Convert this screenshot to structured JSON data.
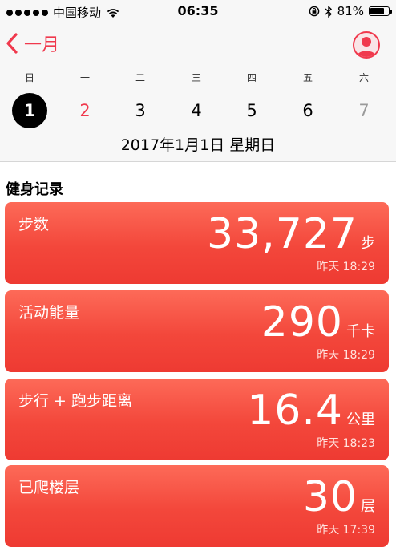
{
  "status_bar": {
    "carrier": "中国移动",
    "time": "06:35",
    "battery": "81%",
    "battery_level": 0.81
  },
  "nav": {
    "back_label": "一月"
  },
  "week": {
    "weekday_labels": [
      "日",
      "一",
      "二",
      "三",
      "四",
      "五",
      "六"
    ],
    "days": [
      "1",
      "2",
      "3",
      "4",
      "5",
      "6",
      "7"
    ],
    "selected_day": "1",
    "date_text": "2017年1月1日 星期日"
  },
  "section": {
    "title": "健身记录"
  },
  "cards": [
    {
      "label": "步数",
      "value": "33,727",
      "unit": "步",
      "time": "昨天 18:29"
    },
    {
      "label": "活动能量",
      "value": "290",
      "unit": "千卡",
      "time": "昨天 18:29"
    },
    {
      "label": "步行 + 跑步距离",
      "value": "16.4",
      "unit": "公里",
      "time": "昨天 18:23"
    },
    {
      "label": "已爬楼层",
      "value": "30",
      "unit": "层",
      "time": "昨天 17:39"
    }
  ],
  "colors": {
    "accent": "#f0394d",
    "card_top": "#fd6a58",
    "card_bottom": "#ee3a32"
  }
}
